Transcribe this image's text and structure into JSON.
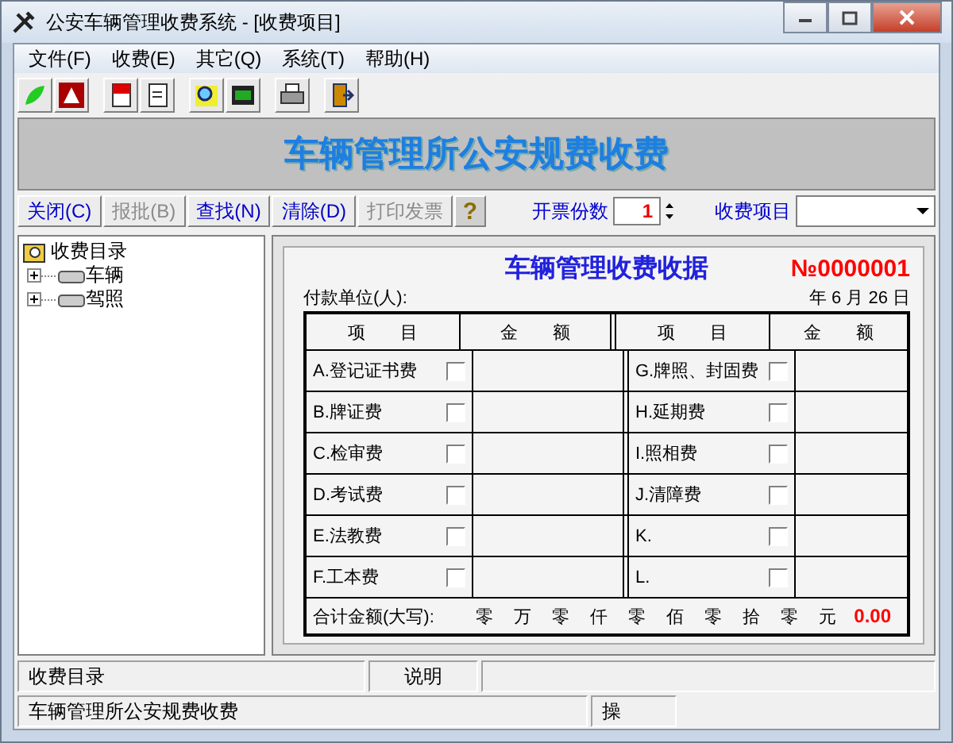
{
  "window": {
    "title": "公安车辆管理收费系统 - [收费项目]"
  },
  "menu": [
    "文件(F)",
    "收费(E)",
    "其它(Q)",
    "系统(T)",
    "帮助(H)"
  ],
  "banner": "车辆管理所公安规费收费",
  "buttons": [
    {
      "label": "关闭(C)",
      "disabled": false
    },
    {
      "label": "报批(B)",
      "disabled": true
    },
    {
      "label": "查找(N)",
      "disabled": false
    },
    {
      "label": "清除(D)",
      "disabled": false
    },
    {
      "label": "打印发票",
      "disabled": true
    }
  ],
  "help_button": "?",
  "copies": {
    "label": "开票份数",
    "value": "1"
  },
  "fee_item": {
    "label": "收费项目"
  },
  "tree": [
    {
      "label": "收费目录",
      "children": [
        {
          "label": "车辆",
          "expanded": false
        },
        {
          "label": "驾照",
          "expanded": false
        }
      ]
    }
  ],
  "receipt": {
    "title": "车辆管理收费收据",
    "number": "№0000001",
    "payer_label": "付款单位(人):",
    "date": "年 6 月 26 日",
    "columns": [
      "项　　目",
      "金　　额",
      "项　　目",
      "金　　额"
    ],
    "left_items": [
      {
        "label": "A.登记证书费",
        "checked": false
      },
      {
        "label": "B.牌证费",
        "checked": false
      },
      {
        "label": "C.检审费",
        "checked": false
      },
      {
        "label": "D.考试费",
        "checked": false
      },
      {
        "label": "E.法教费",
        "checked": false
      },
      {
        "label": "F.工本费",
        "checked": false
      }
    ],
    "right_items": [
      {
        "label": "G.牌照、封固费",
        "checked": false
      },
      {
        "label": "H.延期费",
        "checked": false
      },
      {
        "label": "I.照相费",
        "checked": false
      },
      {
        "label": "J.清障费",
        "checked": false
      },
      {
        "label": "K.",
        "checked": false
      },
      {
        "label": "L.",
        "checked": false
      }
    ],
    "total_label": "合计金额(大写):",
    "total_words": [
      "零",
      "万",
      "零",
      "仟",
      "零",
      "佰",
      "零",
      "拾",
      "零",
      "元"
    ],
    "total_amount": "0.00"
  },
  "status_bar": [
    "收费目录",
    "说明"
  ],
  "status_bar_2": [
    "车辆管理所公安规费收费",
    "操"
  ]
}
